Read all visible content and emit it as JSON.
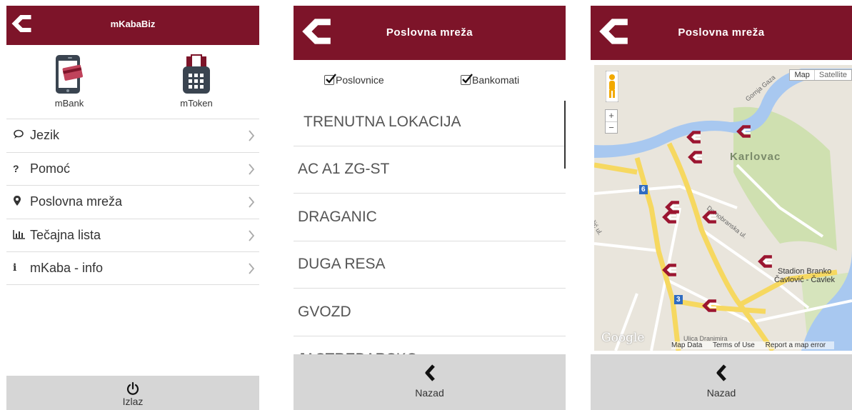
{
  "colors": {
    "brand": "#7d1429",
    "footer": "#d6d6d6"
  },
  "screen1": {
    "title": "mKabaBiz",
    "apps": [
      {
        "label": "mBank",
        "icon": "phone-card-icon"
      },
      {
        "label": "mToken",
        "icon": "token-device-icon"
      }
    ],
    "menu": [
      {
        "label": "Jezik",
        "icon": "chat-icon"
      },
      {
        "label": "Pomoć",
        "icon": "question-icon"
      },
      {
        "label": "Poslovna mreža",
        "icon": "map-pin-icon"
      },
      {
        "label": "Tečajna lista",
        "icon": "bar-chart-icon"
      },
      {
        "label": "mKaba - info",
        "icon": "info-icon"
      }
    ],
    "footer": {
      "label": "Izlaz",
      "icon": "power-icon"
    }
  },
  "screen2": {
    "title": "Poslovna mreža",
    "filters": [
      {
        "label": "Poslovnice",
        "checked": true
      },
      {
        "label": "Bankomati",
        "checked": true
      }
    ],
    "locations": [
      "TRENUTNA LOKACIJA",
      "AC A1 ZG-ST",
      "DRAGANIC",
      "DUGA RESA",
      "GVOZD",
      "JASTREBARSKO"
    ],
    "footer": {
      "label": "Nazad",
      "icon": "chevron-left-icon"
    }
  },
  "screen3": {
    "title": "Poslovna mreža",
    "map": {
      "type_options": [
        "Map",
        "Satellite"
      ],
      "zoom_in": "+",
      "zoom_out": "−",
      "city": "Karlovac",
      "streets": [
        "Domobranska ul.",
        "Gornja Gaza",
        "Ulica Dranimira",
        "čić ul."
      ],
      "stadium": [
        "Stadion Branko",
        "Čavlović - Čavlek"
      ],
      "road_numbers": [
        "6",
        "3"
      ],
      "google": "Google",
      "attribution": [
        "Map Data",
        "Terms of Use",
        "Report a map error"
      ]
    },
    "footer": {
      "label": "Nazad",
      "icon": "chevron-left-icon"
    }
  }
}
